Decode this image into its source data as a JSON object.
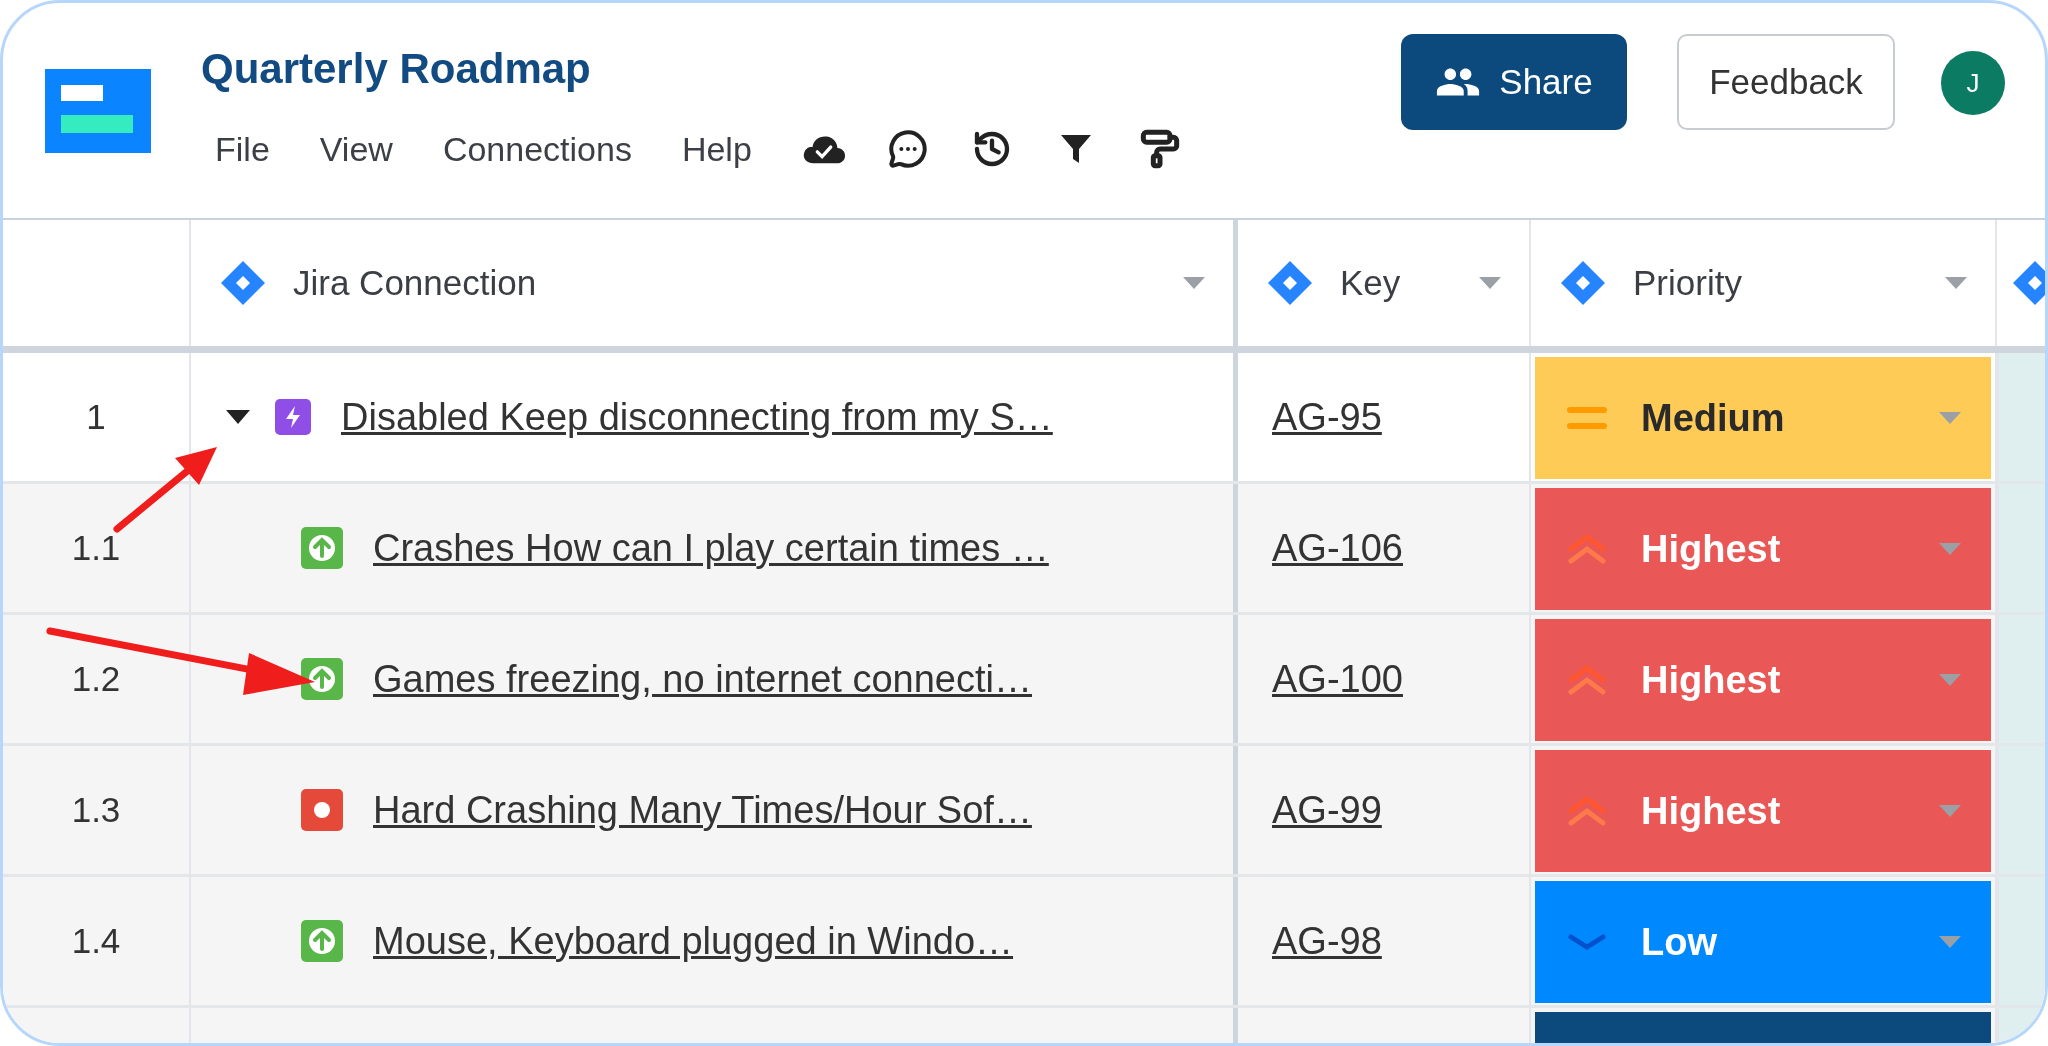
{
  "app": {
    "title": "Quarterly Roadmap",
    "menu": [
      "File",
      "View",
      "Connections",
      "Help"
    ],
    "share_button": "Share",
    "feedback_button": "Feedback",
    "avatar_initial": "J"
  },
  "table": {
    "columns": [
      {
        "label": "Jira Connection"
      },
      {
        "label": "Key"
      },
      {
        "label": "Priority"
      }
    ],
    "rows": [
      {
        "kind": "epic",
        "number": "1",
        "expanded": true,
        "summary": "Disabled Keep disconnecting from my S…",
        "key": "AG-95",
        "priority": {
          "kind": "medium",
          "label": "Medium"
        },
        "children": [
          {
            "kind": "story",
            "number": "1.1",
            "summary": "Crashes How can I play certain times …",
            "key": "AG-106",
            "priority": {
              "kind": "highest",
              "label": "Highest"
            }
          },
          {
            "kind": "story",
            "number": "1.2",
            "summary": "Games freezing, no internet connecti…",
            "key": "AG-100",
            "priority": {
              "kind": "highest",
              "label": "Highest"
            }
          },
          {
            "kind": "bug",
            "number": "1.3",
            "summary": "Hard Crashing Many Times/Hour Sof…",
            "key": "AG-99",
            "priority": {
              "kind": "highest",
              "label": "Highest"
            }
          },
          {
            "kind": "story",
            "number": "1.4",
            "summary": "Mouse, Keyboard plugged in Windo…",
            "key": "AG-98",
            "priority": {
              "kind": "low",
              "label": "Low"
            }
          },
          {
            "kind": "cut_off",
            "priority": {
              "kind": "lowest"
            }
          }
        ]
      }
    ]
  }
}
